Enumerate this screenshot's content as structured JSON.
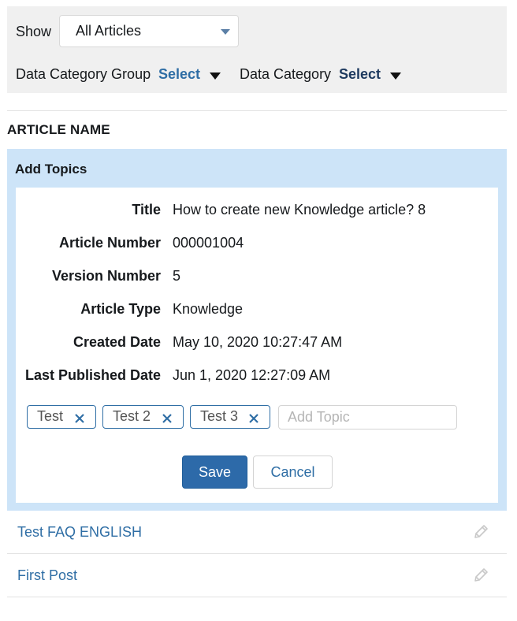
{
  "filters": {
    "show_label": "Show",
    "show_value": "All Articles",
    "data_category_group_label": "Data Category Group",
    "data_category_group_value": "Select",
    "data_category_label": "Data Category",
    "data_category_value": "Select"
  },
  "list": {
    "column_header": "ARTICLE NAME"
  },
  "add_topics": {
    "title": "Add Topics",
    "fields": [
      {
        "label": "Title",
        "value": "How to create new Knowledge article? 8"
      },
      {
        "label": "Article Number",
        "value": "000001004"
      },
      {
        "label": "Version Number",
        "value": "5"
      },
      {
        "label": "Article Type",
        "value": "Knowledge"
      },
      {
        "label": "Created Date",
        "value": "May 10, 2020 10:27:47 AM"
      },
      {
        "label": "Last Published Date",
        "value": "Jun 1, 2020 12:27:09 AM"
      }
    ],
    "topics": [
      "Test",
      "Test 2",
      "Test 3"
    ],
    "add_topic_placeholder": "Add Topic",
    "save_label": "Save",
    "cancel_label": "Cancel"
  },
  "articles": [
    {
      "name": "Test FAQ ENGLISH"
    },
    {
      "name": "First Post"
    }
  ],
  "colors": {
    "accent": "#2f6ea5",
    "panel_bg": "#cde4f8",
    "filter_bg": "#f0f0f0",
    "save_bg": "#2d6aa9"
  },
  "icons": {
    "dropdown": "caret-down-icon",
    "remove_topic": "close-icon",
    "edit": "pencil-icon"
  }
}
